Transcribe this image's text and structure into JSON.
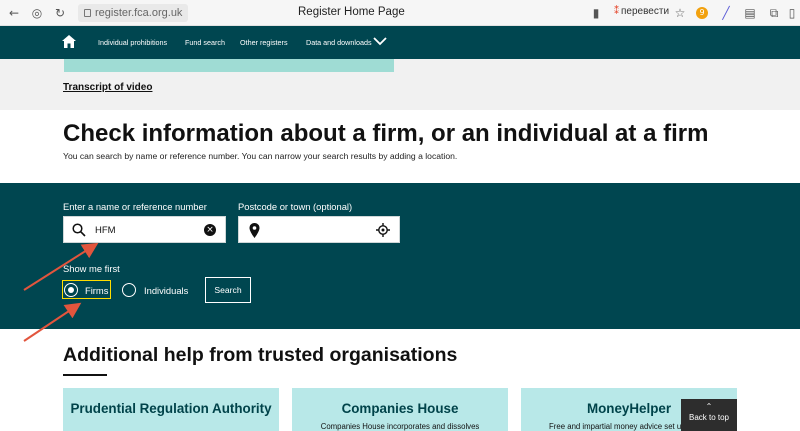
{
  "browser": {
    "url": "register.fca.org.uk",
    "tab_title": "Register Home Page",
    "translate_label": "перевести",
    "extension_badge": "9"
  },
  "nav": {
    "items": [
      {
        "label": "Individual prohibitions"
      },
      {
        "label": "Fund search"
      },
      {
        "label": "Other registers"
      },
      {
        "label": "Data and downloads"
      }
    ]
  },
  "video": {
    "transcript_link": "Transcript of video"
  },
  "main": {
    "title": "Check information about a firm, or an individual at a firm",
    "subtitle": "You can search by name or reference number. You can narrow your search results by adding a location."
  },
  "search": {
    "name_label": "Enter a name or reference number",
    "name_value": "HFM",
    "postcode_label": "Postcode or town (optional)",
    "postcode_value": "",
    "show_first_label": "Show me first",
    "options": [
      {
        "label": "Firms",
        "checked": true
      },
      {
        "label": "Individuals",
        "checked": false
      }
    ],
    "search_button": "Search"
  },
  "help": {
    "title": "Additional help from trusted organisations",
    "cards": [
      {
        "title": "Prudential Regulation Authority",
        "desc": ""
      },
      {
        "title": "Companies House",
        "desc": "Companies House incorporates and dissolves"
      },
      {
        "title": "MoneyHelper",
        "desc": "Free and impartial money advice set up by the"
      }
    ]
  },
  "back_to_top": "Back to top",
  "colors": {
    "brand_teal": "#004650",
    "card_bg": "#b8e8e8",
    "focus_ring": "#ffdd00",
    "annotation_arrow": "#e2553d"
  }
}
